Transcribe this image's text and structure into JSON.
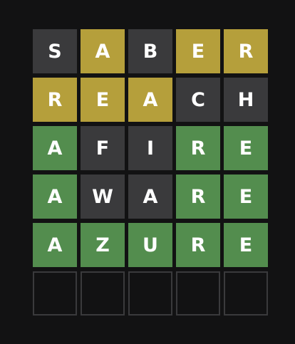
{
  "colors": {
    "background": "#121213",
    "absent": "#3a3a3c",
    "present": "#b59f3b",
    "correct": "#538d4e",
    "empty_border": "#3a3a3c",
    "letter": "#ffffff"
  },
  "board": {
    "rows": [
      {
        "tiles": [
          {
            "letter": "S",
            "state": "absent"
          },
          {
            "letter": "A",
            "state": "present"
          },
          {
            "letter": "B",
            "state": "absent"
          },
          {
            "letter": "E",
            "state": "present"
          },
          {
            "letter": "R",
            "state": "present"
          }
        ]
      },
      {
        "tiles": [
          {
            "letter": "R",
            "state": "present"
          },
          {
            "letter": "E",
            "state": "present"
          },
          {
            "letter": "A",
            "state": "present"
          },
          {
            "letter": "C",
            "state": "absent"
          },
          {
            "letter": "H",
            "state": "absent"
          }
        ]
      },
      {
        "tiles": [
          {
            "letter": "A",
            "state": "correct"
          },
          {
            "letter": "F",
            "state": "absent"
          },
          {
            "letter": "I",
            "state": "absent"
          },
          {
            "letter": "R",
            "state": "correct"
          },
          {
            "letter": "E",
            "state": "correct"
          }
        ]
      },
      {
        "tiles": [
          {
            "letter": "A",
            "state": "correct"
          },
          {
            "letter": "W",
            "state": "absent"
          },
          {
            "letter": "A",
            "state": "absent"
          },
          {
            "letter": "R",
            "state": "correct"
          },
          {
            "letter": "E",
            "state": "correct"
          }
        ]
      },
      {
        "tiles": [
          {
            "letter": "A",
            "state": "correct"
          },
          {
            "letter": "Z",
            "state": "correct"
          },
          {
            "letter": "U",
            "state": "correct"
          },
          {
            "letter": "R",
            "state": "correct"
          },
          {
            "letter": "E",
            "state": "correct"
          }
        ]
      },
      {
        "tiles": [
          {
            "letter": "",
            "state": "empty"
          },
          {
            "letter": "",
            "state": "empty"
          },
          {
            "letter": "",
            "state": "empty"
          },
          {
            "letter": "",
            "state": "empty"
          },
          {
            "letter": "",
            "state": "empty"
          }
        ]
      }
    ]
  }
}
